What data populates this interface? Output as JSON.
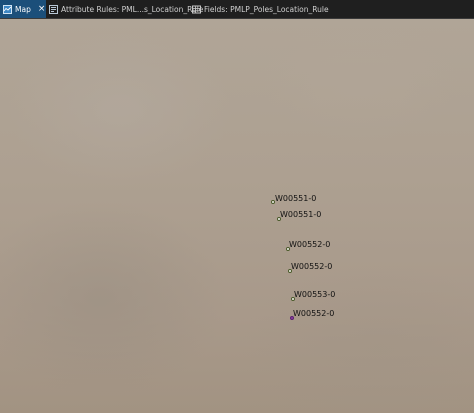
{
  "tabs": [
    {
      "label": "Map",
      "active": true,
      "icon": "map-icon",
      "closable": true
    },
    {
      "label": "Attribute Rules: PML...s_Location_Rule",
      "active": false,
      "icon": "attribute-rules-icon"
    },
    {
      "label": "Fields:  PMLP_Poles_Location_Rule",
      "active": false,
      "icon": "fields-table-icon"
    }
  ],
  "map": {
    "points": [
      {
        "label": "W00551-0",
        "selected": false
      },
      {
        "label": "W00551-0",
        "selected": false
      },
      {
        "label": "W00552-0",
        "selected": false
      },
      {
        "label": "W00552-0",
        "selected": false
      },
      {
        "label": "W00553-0",
        "selected": false
      },
      {
        "label": "W00552-0",
        "selected": true
      }
    ]
  },
  "colors": {
    "active_tab": "#1b4f7a",
    "point_fill": "#f3f3ee",
    "selected_point_fill": "#8a3fa0"
  }
}
